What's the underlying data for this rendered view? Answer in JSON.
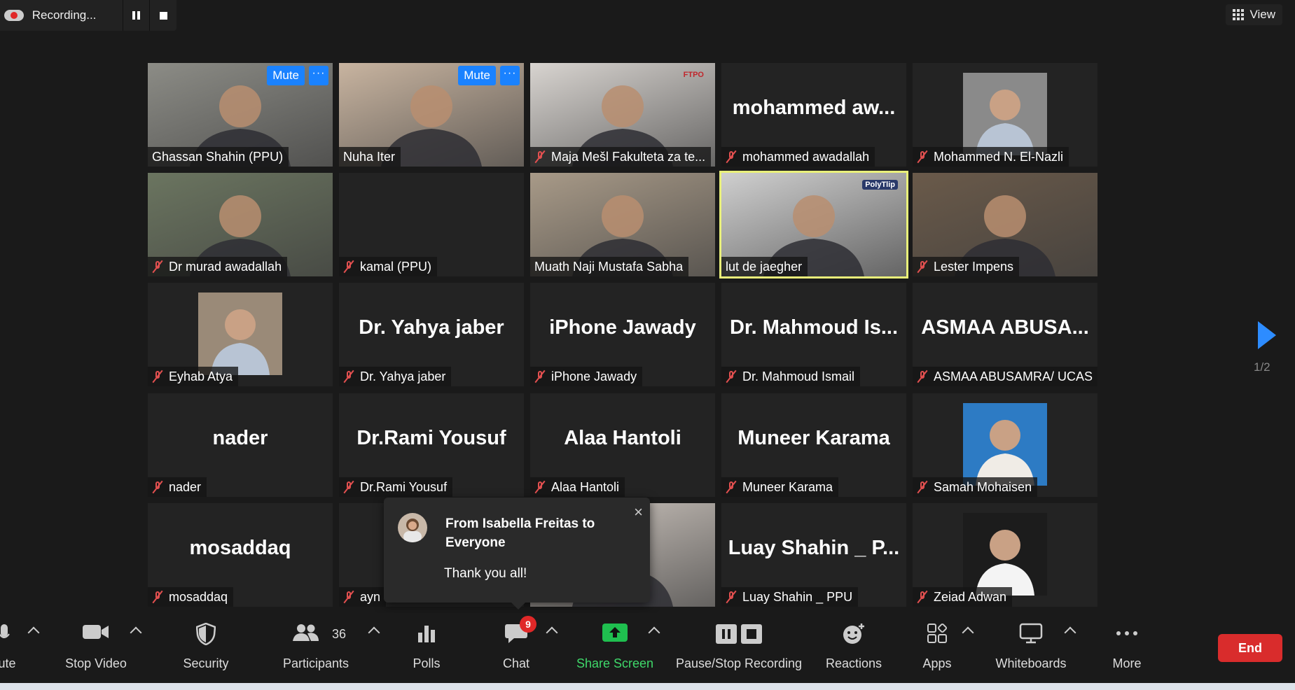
{
  "recording": {
    "label": "Recording..."
  },
  "view": {
    "label": "View"
  },
  "participants": [
    {
      "name": "Ghassan Shahin (PPU)",
      "muted": false,
      "video": true,
      "mute_label": "Mute",
      "more_label": "···"
    },
    {
      "name": "Nuha Iter",
      "muted": false,
      "video": true,
      "mute_label": "Mute",
      "more_label": "···"
    },
    {
      "name": "Maja Mešl Fakulteta za te...",
      "muted": true,
      "video": true,
      "overlay": "FTPO"
    },
    {
      "name": "mohammed awadallah",
      "muted": true,
      "video": false,
      "big": "mohammed  aw..."
    },
    {
      "name": "Mohammed N. El-Nazli",
      "muted": true,
      "video": true
    },
    {
      "name": "Dr murad awadallah",
      "muted": true,
      "video": true
    },
    {
      "name": "kamal (PPU)",
      "muted": true,
      "video": false,
      "big": ""
    },
    {
      "name": "Muath Naji Mustafa Sabha",
      "muted": false,
      "video": true
    },
    {
      "name": "lut de jaegher",
      "muted": false,
      "video": true,
      "active": true,
      "overlay": "PolyTlip"
    },
    {
      "name": "Lester Impens",
      "muted": true,
      "video": true
    },
    {
      "name": "Eyhab Atya",
      "muted": true,
      "video": true
    },
    {
      "name": "Dr. Yahya jaber",
      "muted": true,
      "video": false,
      "big": "Dr. Yahya jaber"
    },
    {
      "name": "iPhone Jawady",
      "muted": true,
      "video": false,
      "big": "iPhone Jawady"
    },
    {
      "name": "Dr. Mahmoud Ismail",
      "muted": true,
      "video": false,
      "big": "Dr. Mahmoud  Is..."
    },
    {
      "name": "ASMAA ABUSAMRA/ UCAS",
      "muted": true,
      "video": false,
      "big": "ASMAA  ABUSA..."
    },
    {
      "name": "nader",
      "muted": true,
      "video": false,
      "big": "nader"
    },
    {
      "name": "Dr.Rami Yousuf",
      "muted": true,
      "video": false,
      "big": "Dr.Rami Yousuf"
    },
    {
      "name": "Alaa Hantoli",
      "muted": true,
      "video": false,
      "big": "Alaa Hantoli"
    },
    {
      "name": "Muneer Karama",
      "muted": true,
      "video": false,
      "big": "Muneer Karama"
    },
    {
      "name": "Samah Mohaisen",
      "muted": true,
      "video": true
    },
    {
      "name": "mosaddaq",
      "muted": true,
      "video": false,
      "big": "mosaddaq"
    },
    {
      "name": "ayn",
      "muted": true,
      "video": false,
      "big": ""
    },
    {
      "name": "",
      "muted": false,
      "video": true,
      "hidden_name": true
    },
    {
      "name": "Luay Shahin _ PPU",
      "muted": true,
      "video": false,
      "big": "Luay Shahin  _  P..."
    },
    {
      "name": "Zeiad Adwan",
      "muted": true,
      "video": true
    }
  ],
  "paging": {
    "indicator": "1/2"
  },
  "chat_toast": {
    "from": "From Isabella Freitas to Everyone",
    "message": "Thank you all!",
    "close": "×"
  },
  "toolbar": {
    "unmute_label": "ute",
    "stop_video": "Stop Video",
    "security": "Security",
    "participants": "Participants",
    "participants_count": "36",
    "polls": "Polls",
    "chat": "Chat",
    "chat_badge": "9",
    "share_screen": "Share Screen",
    "recording": "Pause/Stop Recording",
    "reactions": "Reactions",
    "apps": "Apps",
    "whiteboards": "Whiteboards",
    "more": "More",
    "end": "End"
  },
  "colors": {
    "accent": "#1a82ff",
    "muted_red": "#e35050",
    "share_green": "#1fbf4f",
    "end_red": "#d92c2c",
    "active_border": "#e9f07a"
  }
}
